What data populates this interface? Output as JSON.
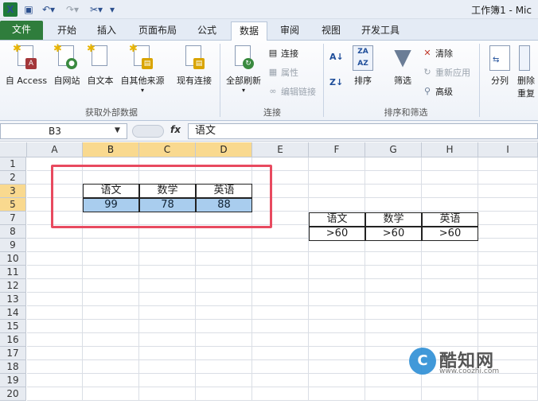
{
  "window": {
    "title": "工作簿1 - Mic"
  },
  "tabs": [
    {
      "label": "文件"
    },
    {
      "label": "开始"
    },
    {
      "label": "插入"
    },
    {
      "label": "页面布局"
    },
    {
      "label": "公式"
    },
    {
      "label": "数据"
    },
    {
      "label": "审阅"
    },
    {
      "label": "视图"
    },
    {
      "label": "开发工具"
    }
  ],
  "ribbon": {
    "external": {
      "access": "自 Access",
      "web": "自网站",
      "text": "自文本",
      "other": "自其他来源",
      "existing": "现有连接",
      "group_label": "获取外部数据"
    },
    "connections": {
      "refresh_all": "全部刷新",
      "connections": "连接",
      "properties": "属性",
      "edit_links": "编辑链接",
      "group_label": "连接"
    },
    "sort_filter": {
      "sort": "排序",
      "filter": "筛选",
      "clear": "清除",
      "reapply": "重新应用",
      "advanced": "高级",
      "group_label": "排序和筛选"
    },
    "tools": {
      "text_to_columns": "分列",
      "remove_duplicates_1": "删除",
      "remove_duplicates_2": "重复"
    }
  },
  "formula_bar": {
    "name_box": "B3",
    "fx": "fx",
    "content": "语文"
  },
  "columns": [
    "A",
    "B",
    "C",
    "D",
    "E",
    "F",
    "G",
    "H",
    "I"
  ],
  "rows": [
    "1",
    "2",
    "3",
    "5",
    "7",
    "8",
    "9",
    "10",
    "11",
    "12",
    "13",
    "14",
    "15",
    "16",
    "17",
    "18",
    "19",
    "20"
  ],
  "data_table": {
    "headers": [
      "语文",
      "数学",
      "英语"
    ],
    "values": [
      "99",
      "78",
      "88"
    ]
  },
  "criteria_table": {
    "headers": [
      "语文",
      "数学",
      "英语"
    ],
    "values": [
      ">60",
      ">60",
      ">60"
    ]
  },
  "watermark": {
    "logo": "C",
    "text": "酷知网",
    "url": "www.coozhi.com"
  },
  "colors": {
    "selected_header": "#f9d98f",
    "cell_highlight": "#a9cdee",
    "annotation_box": "#e84a5f",
    "file_tab": "#2f7d3c"
  }
}
